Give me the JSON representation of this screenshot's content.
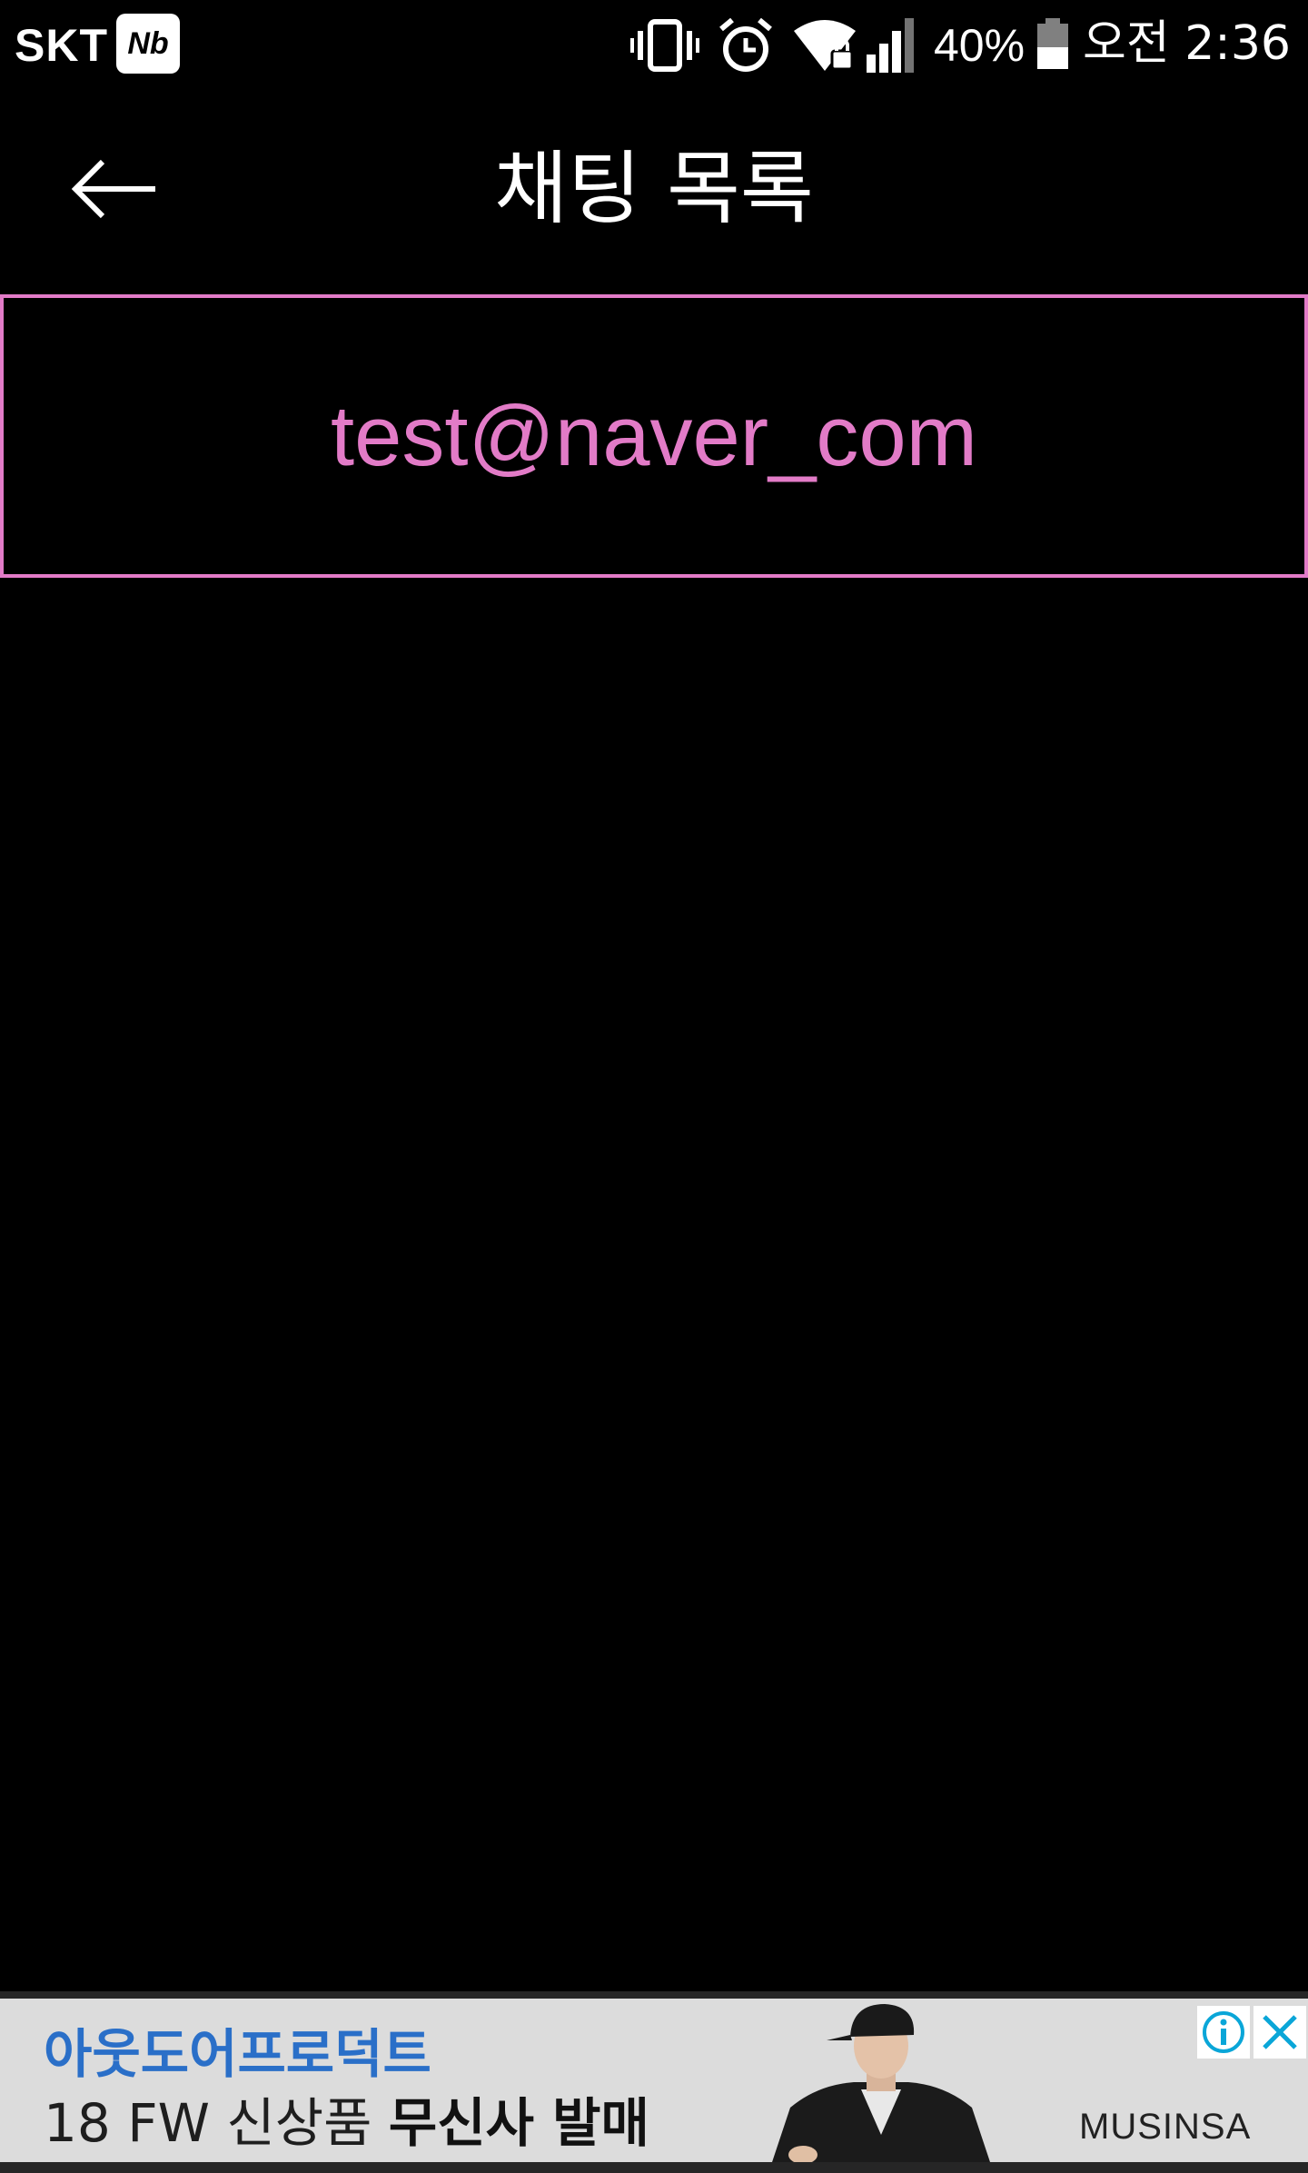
{
  "status_bar": {
    "carrier": "SKT",
    "carrier_badge": "Nb",
    "battery_percent": "40%",
    "time": "오전 2:36",
    "icons": [
      "vibrate-icon",
      "alarm-icon",
      "wifi-icon",
      "signal-icon",
      "battery-icon"
    ]
  },
  "toolbar": {
    "title": "채팅 목록",
    "back_icon": "back-arrow-icon"
  },
  "chat_list": {
    "items": [
      {
        "label": "test@naver_com"
      }
    ]
  },
  "ad": {
    "headline": "아웃도어프로덕트",
    "subline_prefix": "18 FW 신상품 ",
    "subline_bold": "무신사 발매",
    "brand": "MUSINSA",
    "icons": [
      "info-icon",
      "close-icon"
    ]
  },
  "colors": {
    "background": "#000000",
    "accent": "#e27bc7",
    "ad_background": "#dcdcdc",
    "ad_headline": "#2a6fc8",
    "ad_icons": "#0aa6d8"
  }
}
